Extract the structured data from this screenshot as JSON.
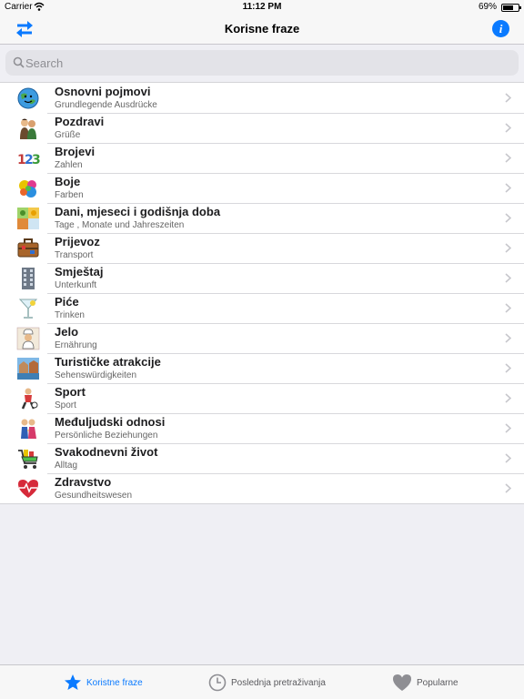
{
  "status_bar": {
    "carrier": "Carrier",
    "time": "11:12 PM",
    "battery_percent": "69%",
    "battery_level": 0.69
  },
  "nav": {
    "title": "Korisne fraze",
    "left_icon": "swap-arrows-icon",
    "right_icon": "info-icon",
    "info_glyph": "i"
  },
  "search": {
    "placeholder": "Search",
    "value": ""
  },
  "categories": [
    {
      "title": "Osnovni pojmovi",
      "subtitle": "Grundlegende Ausdrücke",
      "icon": "globe-smiley-icon"
    },
    {
      "title": "Pozdravi",
      "subtitle": "Grüße",
      "icon": "greeting-people-icon"
    },
    {
      "title": "Brojevi",
      "subtitle": "Zahlen",
      "icon": "numbers-123-icon",
      "icon_text": "123"
    },
    {
      "title": "Boje",
      "subtitle": "Farben",
      "icon": "paint-splash-icon"
    },
    {
      "title": "Dani, mjeseci i godišnja doba",
      "subtitle": "Tage , Monate und Jahreszeiten",
      "icon": "seasons-icon"
    },
    {
      "title": "Prijevoz",
      "subtitle": "Transport",
      "icon": "suitcase-icon"
    },
    {
      "title": "Smještaj",
      "subtitle": "Unterkunft",
      "icon": "building-icon"
    },
    {
      "title": "Piće",
      "subtitle": "Trinken",
      "icon": "cocktail-glass-icon"
    },
    {
      "title": "Jelo",
      "subtitle": "Ernährung",
      "icon": "chef-icon"
    },
    {
      "title": "Turističke atrakcije",
      "subtitle": "Sehenswürdigkeiten",
      "icon": "landmark-icon"
    },
    {
      "title": "Sport",
      "subtitle": "Sport",
      "icon": "athlete-icon"
    },
    {
      "title": "Međuljudski odnosi",
      "subtitle": "Persönliche Beziehungen",
      "icon": "couple-icon"
    },
    {
      "title": "Svakodnevni život",
      "subtitle": "Alltag",
      "icon": "shopping-cart-icon"
    },
    {
      "title": "Zdravstvo",
      "subtitle": "Gesundheitswesen",
      "icon": "heartbeat-icon"
    }
  ],
  "tabs": [
    {
      "label": "Koristne fraze",
      "icon": "star-icon",
      "active": true
    },
    {
      "label": "Poslednja pretraživanja",
      "icon": "clock-icon",
      "active": false
    },
    {
      "label": "Popularne",
      "icon": "heart-icon",
      "active": false
    }
  ],
  "colors": {
    "accent": "#0a7aff",
    "inactive_tab": "#8e8e93"
  }
}
